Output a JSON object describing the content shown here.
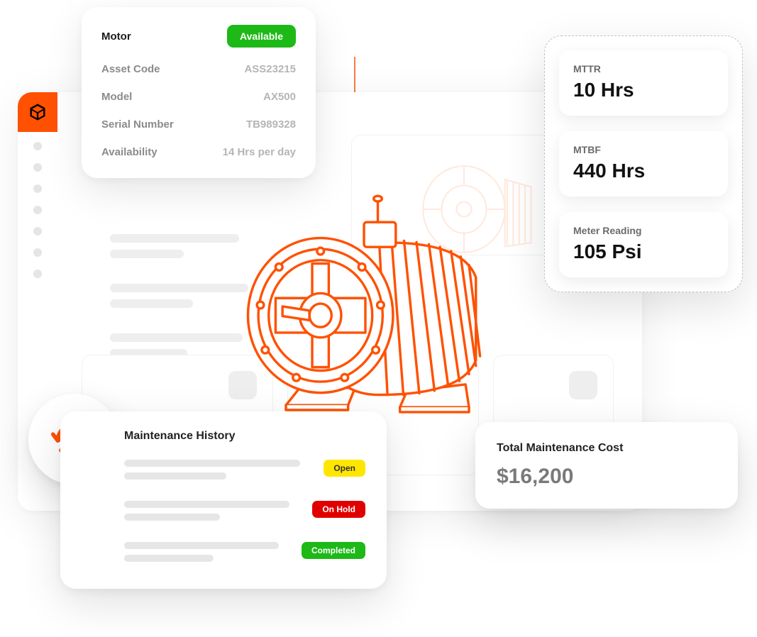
{
  "asset": {
    "title_label": "Motor",
    "status_badge": "Available",
    "rows": [
      {
        "label": "Asset Code",
        "value": "ASS23215"
      },
      {
        "label": "Model",
        "value": "AX500"
      },
      {
        "label": "Serial Number",
        "value": "TB989328"
      },
      {
        "label": "Availability",
        "value": "14 Hrs per day"
      }
    ]
  },
  "metrics": [
    {
      "label": "MTTR",
      "value": "10 Hrs"
    },
    {
      "label": "MTBF",
      "value": "440 Hrs"
    },
    {
      "label": "Meter Reading",
      "value": "105 Psi"
    }
  ],
  "history": {
    "title": "Maintenance History",
    "items": [
      {
        "status": "Open",
        "status_class": "open"
      },
      {
        "status": "On Hold",
        "status_class": "hold"
      },
      {
        "status": "Completed",
        "status_class": "completed"
      }
    ]
  },
  "cost": {
    "label": "Total Maintenance Cost",
    "value": "$16,200"
  },
  "colors": {
    "accent": "#ff5100",
    "available": "#1db917",
    "open": "#ffe600",
    "hold": "#e10000",
    "completed": "#1db917"
  }
}
